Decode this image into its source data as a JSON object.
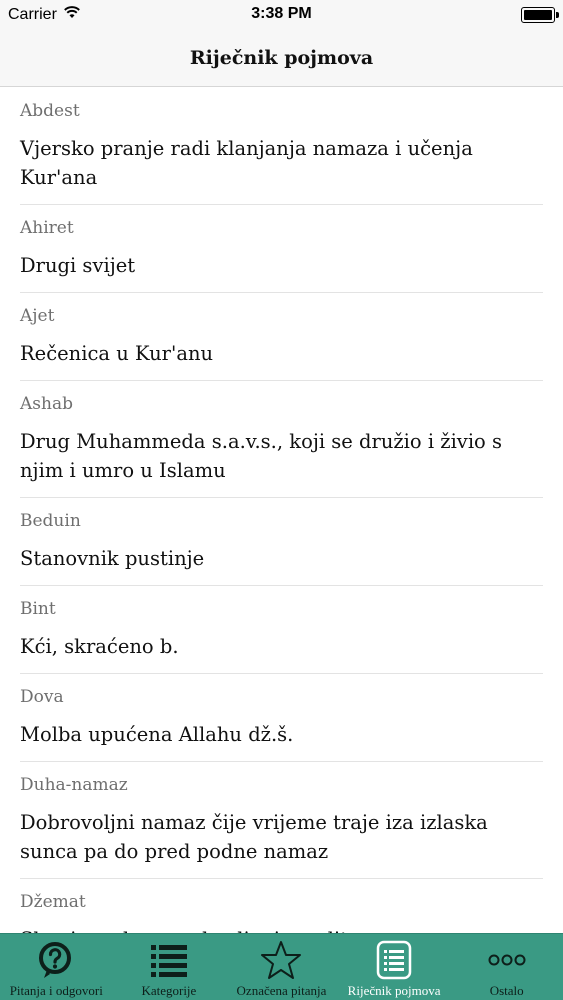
{
  "status_bar": {
    "carrier": "Carrier",
    "time": "3:38 PM",
    "wifi_icon": "wifi-icon",
    "battery_icon": "battery-icon"
  },
  "nav": {
    "title": "Riječnik pojmova"
  },
  "entries": [
    {
      "term": "Abdest",
      "definition": "Vjersko pranje radi klanjanja namaza i učenja Kur'ana"
    },
    {
      "term": "Ahiret",
      "definition": "Drugi svijet"
    },
    {
      "term": "Ajet",
      "definition": "Rečenica u Kur'anu"
    },
    {
      "term": "Ashab",
      "definition": "Drug Muhammeda s.a.v.s., koji se družio i živio s njim i umro u Islamu"
    },
    {
      "term": "Beduin",
      "definition": "Stanovnik pustinje"
    },
    {
      "term": "Bint",
      "definition": "Kći, skraćeno b."
    },
    {
      "term": "Dova",
      "definition": "Molba upućena Allahu dž.š."
    },
    {
      "term": "Duha-namaz",
      "definition": "Dobrovoljni namaz čije vrijeme traje iza izlaska sunca pa do pred podne namaz"
    },
    {
      "term": "Džemat",
      "definition": "Skupina, skupno obavljanje molitve"
    }
  ],
  "tabs": [
    {
      "label": "Pitanja i odgovori",
      "icon": "question-bubble-icon",
      "active": false
    },
    {
      "label": "Kategorije",
      "icon": "list-icon",
      "active": false
    },
    {
      "label": "Označena pitanja",
      "icon": "star-icon",
      "active": false
    },
    {
      "label": "Riječnik pojmova",
      "icon": "document-icon",
      "active": true
    },
    {
      "label": "Ostalo",
      "icon": "more-icon",
      "active": false
    }
  ],
  "colors": {
    "tab_bar": "#3a9a84",
    "active_tab": "#ffffff",
    "inactive_tab": "#0d1f1a"
  }
}
